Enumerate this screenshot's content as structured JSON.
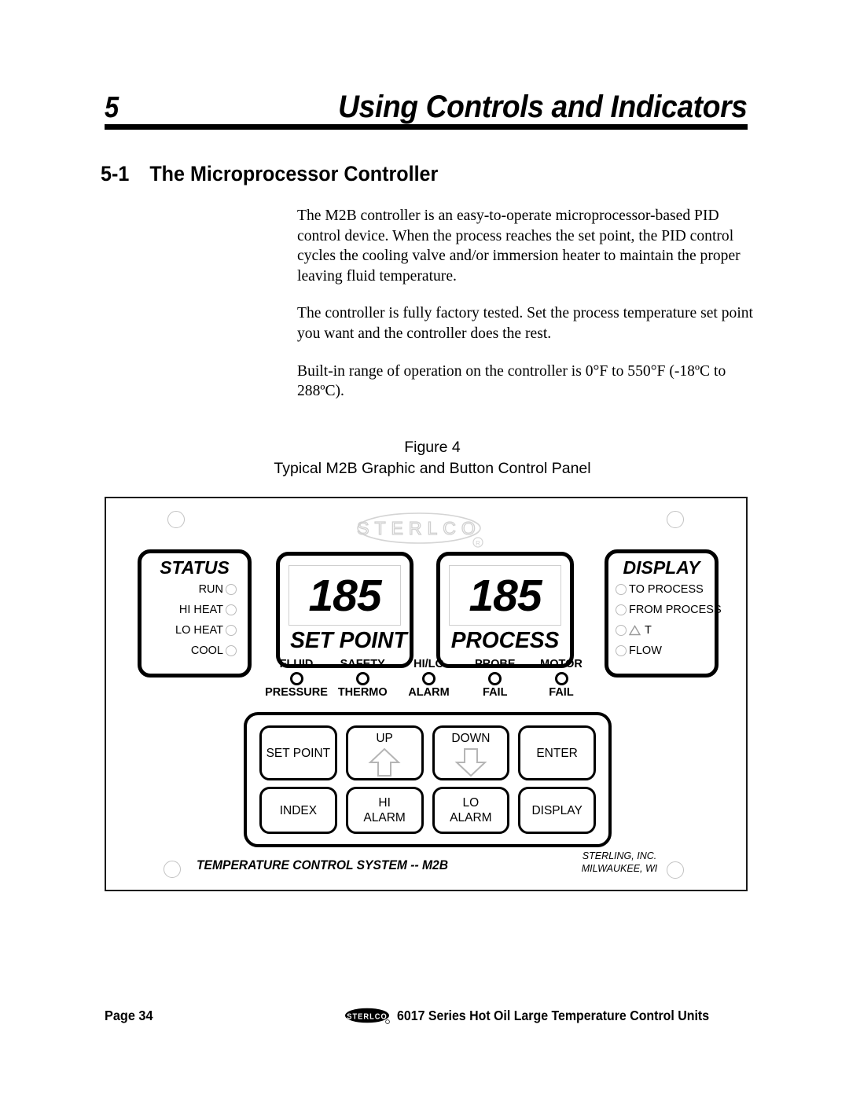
{
  "chapter": {
    "number": "5",
    "title": "Using Controls and Indicators"
  },
  "section": {
    "number": "5-1",
    "title": "The Microprocessor Controller"
  },
  "body": {
    "paragraph1": "The M2B controller is an easy-to-operate microprocessor-based PID control device. When the process reaches the set point, the PID control cycles the cooling valve and/or immersion heater to maintain the proper leaving fluid temperature.",
    "paragraph2": "The controller is fully factory tested. Set the process temperature set point you want and the controller does the rest.",
    "paragraph3": "Built-in range of operation on the controller is 0°F to 550°F (-18ºC to 288ºC)."
  },
  "figure": {
    "number": "Figure 4",
    "caption": "Typical M2B Graphic and Button Control Panel"
  },
  "panel": {
    "brand_logo": "sterlco-outline-logo",
    "status": {
      "title": "STATUS",
      "items": [
        {
          "label": "RUN",
          "indicator": "led-indicator"
        },
        {
          "label": "HI HEAT",
          "indicator": "led-indicator"
        },
        {
          "label": "LO HEAT",
          "indicator": "led-indicator"
        },
        {
          "label": "COOL",
          "indicator": "led-indicator"
        }
      ]
    },
    "setpoint": {
      "value": "185",
      "label": "SET POINT"
    },
    "process": {
      "value": "185",
      "label": "PROCESS"
    },
    "display": {
      "title": "DISPLAY",
      "items": [
        {
          "label": "TO PROCESS",
          "indicator": "led-indicator"
        },
        {
          "label": "FROM PROCESS",
          "indicator": "led-indicator"
        },
        {
          "label": "T",
          "icon": "delta-triangle-icon",
          "indicator": "led-indicator"
        },
        {
          "label": "FLOW",
          "indicator": "led-indicator"
        }
      ]
    },
    "alarms": [
      {
        "top": "FLUID",
        "bottom": "PRESSURE"
      },
      {
        "top": "SAFETY",
        "bottom": "THERMO"
      },
      {
        "top": "HI/LO",
        "bottom": "ALARM"
      },
      {
        "top": "PROBE",
        "bottom": "FAIL"
      },
      {
        "top": "MOTOR",
        "bottom": "FAIL"
      }
    ],
    "keys": [
      {
        "name": "set-point",
        "line1": "SET POINT",
        "line2": "",
        "arrow": ""
      },
      {
        "name": "up",
        "line1": "UP",
        "line2": "",
        "arrow": "up-arrow-icon"
      },
      {
        "name": "down",
        "line1": "DOWN",
        "line2": "",
        "arrow": "down-arrow-icon"
      },
      {
        "name": "enter",
        "line1": "ENTER",
        "line2": "",
        "arrow": ""
      },
      {
        "name": "index",
        "line1": "INDEX",
        "line2": "",
        "arrow": ""
      },
      {
        "name": "hi-alarm",
        "line1": "HI",
        "line2": "ALARM",
        "arrow": ""
      },
      {
        "name": "lo-alarm",
        "line1": "LO",
        "line2": "ALARM",
        "arrow": ""
      },
      {
        "name": "display",
        "line1": "DISPLAY",
        "line2": "",
        "arrow": ""
      }
    ],
    "legend": "TEMPERATURE CONTROL SYSTEM -- M2B",
    "manufacturer_line1": "STERLING, INC.",
    "manufacturer_line2": "MILWAUKEE, WI"
  },
  "footer": {
    "page": "Page 34",
    "logo": "sterlco-logo",
    "title": "6017 Series Hot Oil Large Temperature Control Units"
  },
  "colors": {
    "ink": "#000000",
    "panel_border": "#1a1a1a",
    "led_outline": "#b9b9b9",
    "screen_border": "#cfcfcf",
    "arrow_outline": "#b5b5b5",
    "logo_outline": "#d4d4d4"
  }
}
